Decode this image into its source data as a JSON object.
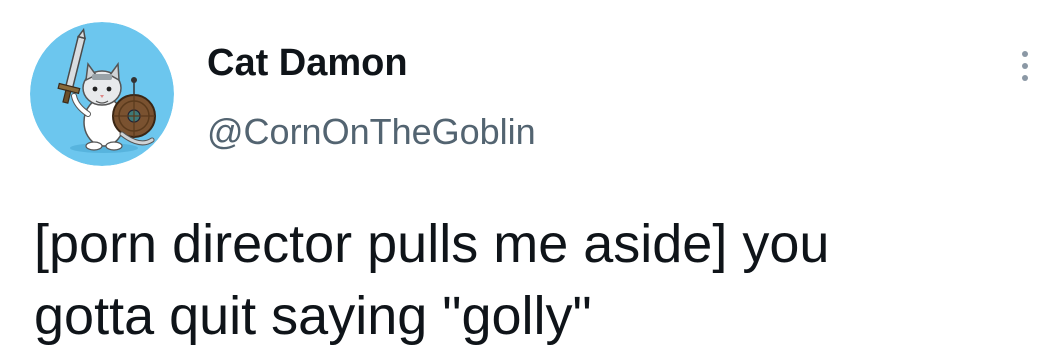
{
  "author": {
    "display_name": "Cat Damon",
    "handle": "@CornOnTheGoblin",
    "avatar_icon": "cat-warrior-avatar",
    "avatar_bg_color": "#6cc6ee"
  },
  "more_menu": {
    "icon": "more-vertical-icon"
  },
  "tweet": {
    "lines": [
      "[porn director pulls me aside] you",
      "gotta quit saying \"golly\""
    ]
  },
  "colors": {
    "text_primary": "#0f1419",
    "text_secondary": "#536471",
    "background": "#ffffff"
  }
}
